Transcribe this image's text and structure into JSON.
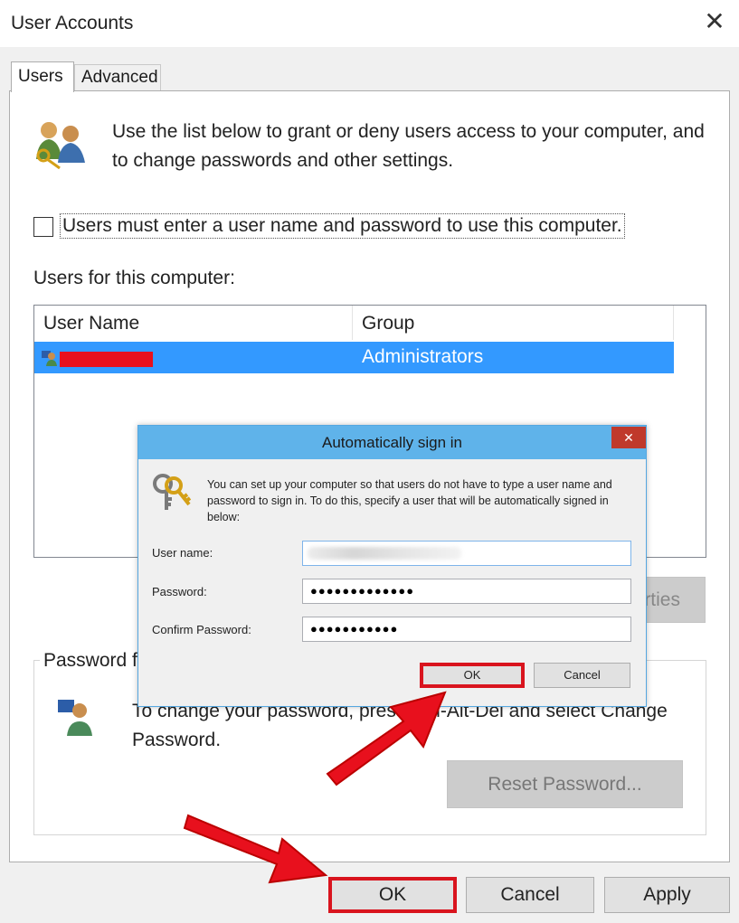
{
  "window": {
    "title": "User Accounts",
    "close_glyph": "✕"
  },
  "tabs": [
    {
      "label": "Users",
      "selected": true
    },
    {
      "label": "Advanced",
      "selected": false
    }
  ],
  "users_tab": {
    "intro_text": "Use the list below to grant or deny users access to your computer, and to change passwords and other settings.",
    "checkbox_label": "Users must enter a user name and password to use this computer.",
    "checkbox_checked": false,
    "users_list_label": "Users for this computer:",
    "columns": [
      "User Name",
      "Group"
    ],
    "rows": [
      {
        "user": "",
        "group": "Administrators",
        "selected": true,
        "redacted": true
      }
    ],
    "properties_button_partial": "rties",
    "password_group_title": "Password f",
    "password_text": "To change your password, press Ctrl-Alt-Del and select Change Password.",
    "reset_button": "Reset Password..."
  },
  "bottom_buttons": {
    "ok": "OK",
    "cancel": "Cancel",
    "apply": "Apply"
  },
  "dialog": {
    "title": "Automatically sign in",
    "close_glyph": "✕",
    "description": "You can set up your computer so that users do not have to type a user name and password to sign in. To do this, specify a user that will be automatically signed in below:",
    "fields": {
      "username_label": "User name:",
      "username_value": "",
      "password_label": "Password:",
      "password_value": "●●●●●●●●●●●●●",
      "confirm_label": "Confirm Password:",
      "confirm_value": "●●●●●●●●●●●"
    },
    "ok_button": "OK",
    "cancel_button": "Cancel"
  },
  "colors": {
    "accent_selection": "#3399ff",
    "dialog_titlebar": "#5fb3ea",
    "highlight_red": "#d9141e",
    "redaction_red": "#e8101d"
  },
  "icons": [
    "users-keys-icon",
    "user-row-icon",
    "user-password-icon",
    "keys-icon",
    "close-icon"
  ]
}
